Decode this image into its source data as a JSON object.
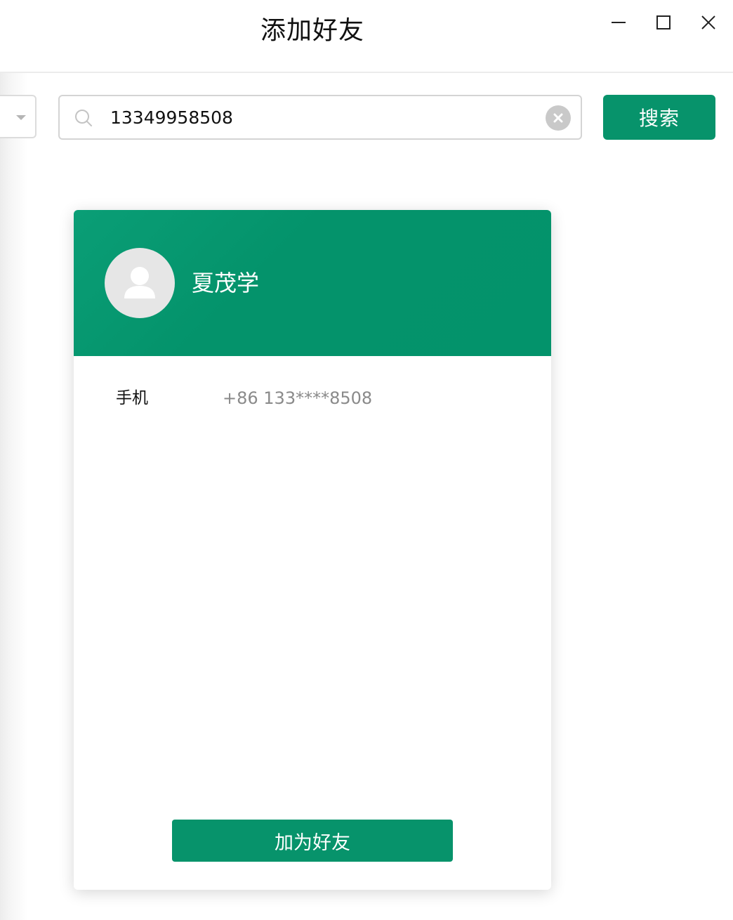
{
  "window": {
    "title": "添加好友",
    "controls": {
      "minimize_icon": "minimize-icon",
      "maximize_icon": "maximize-icon",
      "close_icon": "close-icon"
    }
  },
  "search": {
    "value": "13349958508",
    "button_label": "搜索",
    "icons": [
      "search-icon",
      "clear-icon",
      "chevron-down-icon"
    ]
  },
  "result": {
    "name": "夏茂学",
    "avatar_icon": "user-avatar-icon",
    "fields": [
      {
        "label": "手机",
        "value": "+86 133****8508"
      }
    ],
    "add_button_label": "加为好友"
  },
  "colors": {
    "accent": "#07936b",
    "header": "#03936b",
    "text": "#111111",
    "muted": "#8a8a8a"
  }
}
